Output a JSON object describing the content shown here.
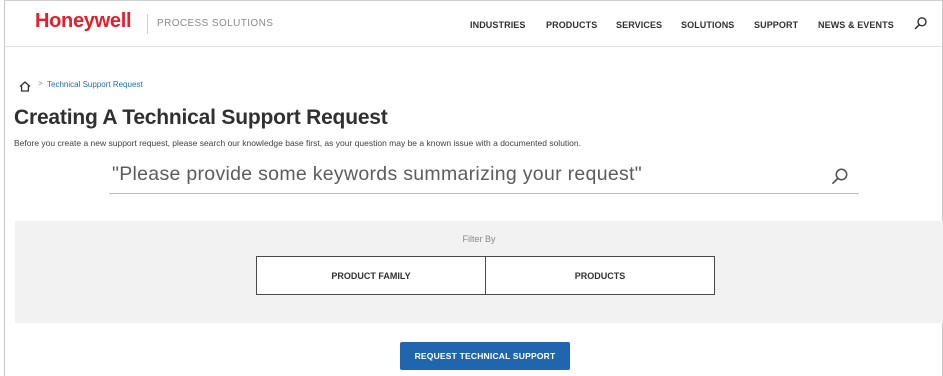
{
  "header": {
    "brand": "Honeywell",
    "tagline": "PROCESS SOLUTIONS",
    "nav": [
      "INDUSTRIES",
      "PRODUCTS",
      "SERVICES",
      "SOLUTIONS",
      "SUPPORT",
      "NEWS & EVENTS"
    ],
    "search_icon": "search-icon"
  },
  "breadcrumb": {
    "home_icon": "home-icon",
    "separator": ">",
    "current": "Technical Support Request"
  },
  "page": {
    "title": "Creating A Technical Support Request",
    "intro": "Before you create a new support request, please search our knowledge base first, as your question may be a known issue with a documented solution."
  },
  "search": {
    "placeholder": "\"Please provide some keywords summarizing your request\"",
    "icon": "search-icon"
  },
  "filter": {
    "label": "Filter By",
    "options": [
      "PRODUCT FAMILY",
      "PRODUCTS"
    ]
  },
  "cta": {
    "label": "REQUEST TECHNICAL SUPPORT"
  },
  "colors": {
    "brand_red": "#e41e2b",
    "link_blue": "#1f6fb2",
    "button_blue": "#1f66ae",
    "panel_gray": "#f2f2f2"
  }
}
